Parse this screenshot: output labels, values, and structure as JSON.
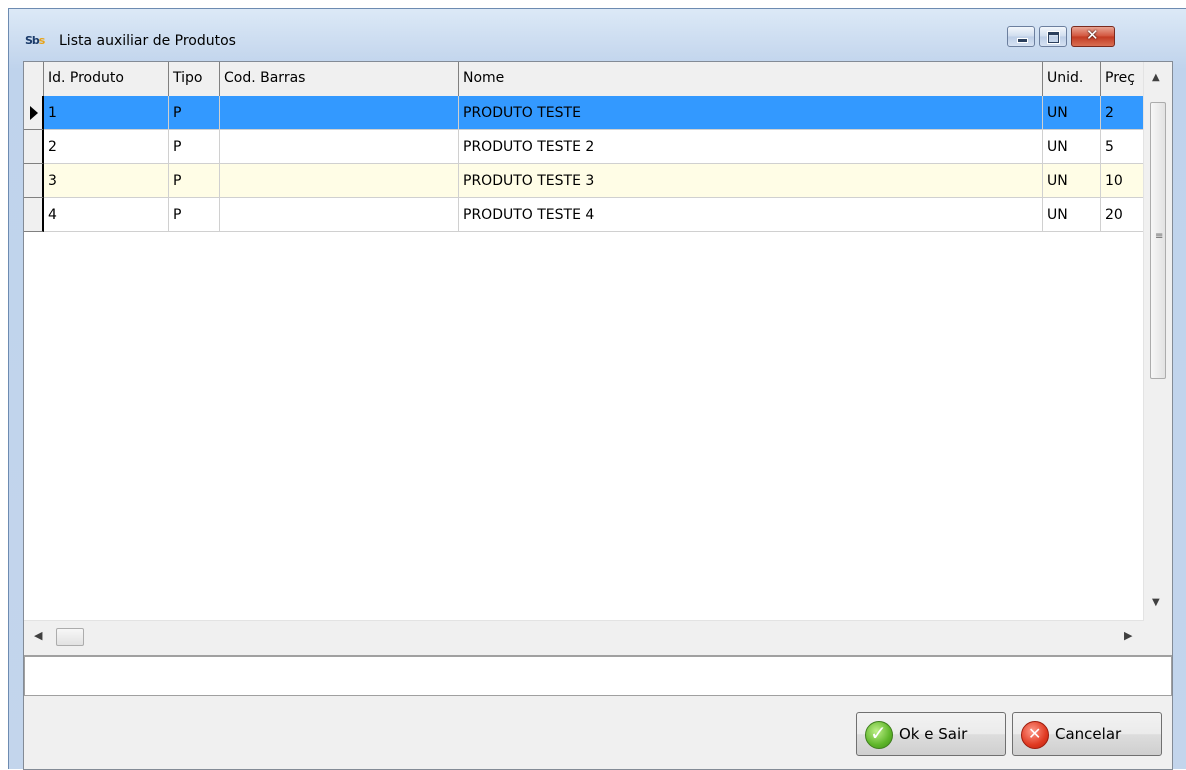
{
  "window": {
    "title": "Lista auxiliar de Produtos",
    "icon_text_a": "Sb",
    "icon_text_b": "s"
  },
  "grid": {
    "columns": [
      "Id. Produto",
      "Tipo",
      "Cod. Barras",
      "Nome",
      "Unid.",
      "Preç"
    ],
    "rows": [
      {
        "id": "1",
        "tipo": "P",
        "cod": "",
        "nome": "PRODUTO TESTE",
        "unid": "UN",
        "preco": "2"
      },
      {
        "id": "2",
        "tipo": "P",
        "cod": "",
        "nome": "PRODUTO TESTE 2",
        "unid": "UN",
        "preco": "5"
      },
      {
        "id": "3",
        "tipo": "P",
        "cod": "",
        "nome": "PRODUTO TESTE 3",
        "unid": "UN",
        "preco": "10"
      },
      {
        "id": "4",
        "tipo": "P",
        "cod": "",
        "nome": "PRODUTO TESTE 4",
        "unid": "UN",
        "preco": "20"
      }
    ]
  },
  "buttons": {
    "ok_label": "Ok e Sair",
    "cancel_label": "Cancelar"
  },
  "colors": {
    "selection": "#3399ff",
    "alt_row": "#fffde6"
  }
}
